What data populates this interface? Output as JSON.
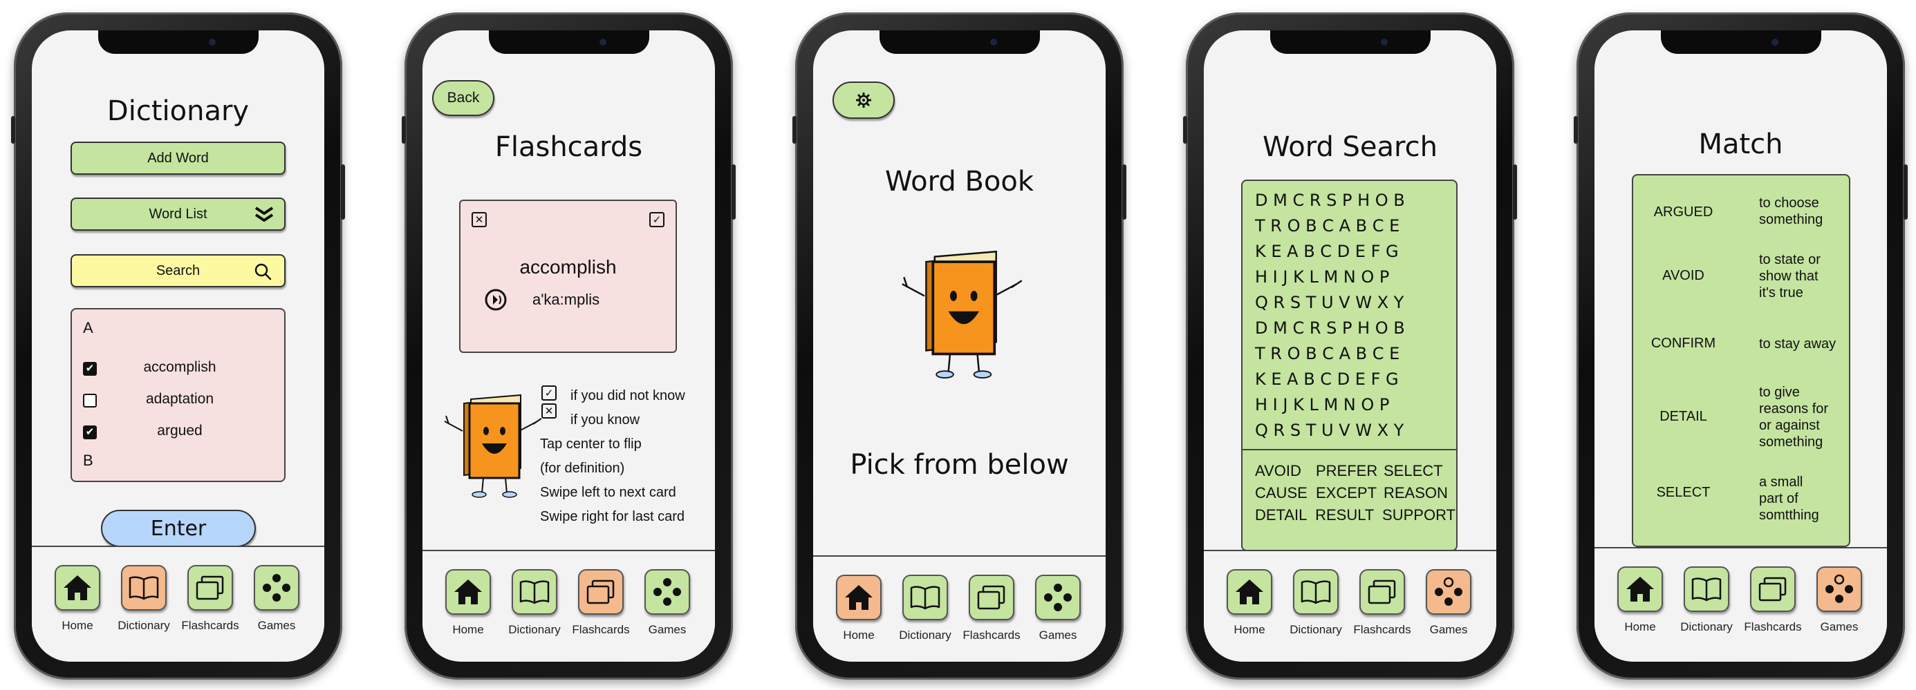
{
  "nav": {
    "home": "Home",
    "dictionary": "Dictionary",
    "flashcards": "Flashcards",
    "games": "Games"
  },
  "colors": {
    "green": "#c4e4a0",
    "orange": "#f4b98c",
    "pink": "#f6e0e0",
    "yellow": "#fdf9a0",
    "blue": "#b7d6fb",
    "book": "#f7941d"
  },
  "dictionary": {
    "title": "Dictionary",
    "add_word": "Add Word",
    "word_list": "Word List",
    "search_placeholder": "Search",
    "section_a": "A",
    "section_b": "B",
    "words": [
      {
        "label": "accomplish",
        "checked": true
      },
      {
        "label": "adaptation",
        "checked": false
      },
      {
        "label": "argued",
        "checked": true
      }
    ],
    "enter": "Enter"
  },
  "flashcards": {
    "back": "Back",
    "title": "Flashcards",
    "word": "accomplish",
    "pronunciation": "a'ka:mplis",
    "instructions": [
      "if you did not know",
      "if you know",
      "Tap center to flip",
      "(for definition)",
      "Swipe left to next card",
      "Swipe right for last card"
    ]
  },
  "wordbook": {
    "settings_icon": "gear-icon",
    "title": "Word Book",
    "subtitle": "Pick from below"
  },
  "wordsearch": {
    "title": "Word Search",
    "rows": [
      "D M C R S P H O B",
      "T R O B C A B C E",
      "K E A B C D E F G",
      "H I J K L M N O P",
      "Q R S T U V W X Y",
      "D M C R S P H O B",
      "T R O B C A B C E",
      "K E A B C D E F G",
      "H I J K L M N O P",
      "Q R S T U V W X Y"
    ],
    "word_rows": [
      [
        "AVOID",
        "PREFER",
        "SELECT"
      ],
      [
        "CAUSE",
        "EXCEPT",
        "REASON"
      ],
      [
        "DETAIL",
        "RESULT",
        "SUPPORT"
      ]
    ]
  },
  "match": {
    "title": "Match",
    "words": [
      "ARGUED",
      "AVOID",
      "CONFIRM",
      "DETAIL",
      "SELECT"
    ],
    "definitions": [
      [
        "to choose",
        "something"
      ],
      [
        "to state or",
        "show that",
        "it's true"
      ],
      [
        "to stay away"
      ],
      [
        "to give",
        "reasons for",
        "or against",
        "something"
      ],
      [
        "a small",
        "part of",
        "somtthing"
      ]
    ]
  }
}
